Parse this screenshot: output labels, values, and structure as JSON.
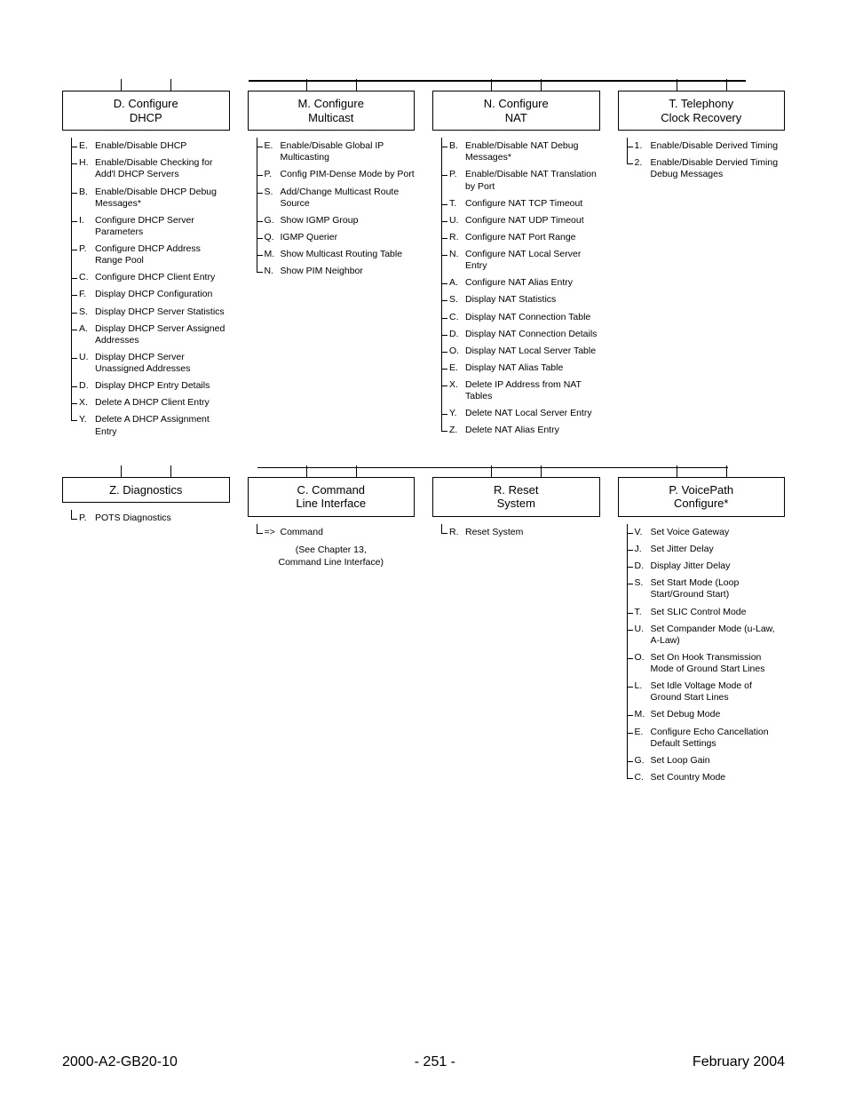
{
  "row1": {
    "cols": [
      {
        "header": "D. Configure\nDHCP",
        "items": [
          {
            "k": "E.",
            "t": "Enable/Disable DHCP"
          },
          {
            "k": "H.",
            "t": "Enable/Disable Checking for Add'l DHCP Servers"
          },
          {
            "k": "B.",
            "t": "Enable/Disable DHCP Debug Messages*"
          },
          {
            "k": "I.",
            "t": "Configure DHCP Server Parameters"
          },
          {
            "k": "P.",
            "t": "Configure DHCP Address Range Pool"
          },
          {
            "k": "C.",
            "t": "Configure DHCP Client Entry"
          },
          {
            "k": "F.",
            "t": "Display DHCP Configuration"
          },
          {
            "k": "S.",
            "t": "Display DHCP Server Statistics"
          },
          {
            "k": "A.",
            "t": "Display DHCP Server Assigned Addresses"
          },
          {
            "k": "U.",
            "t": "Display DHCP Server Unassigned Addresses"
          },
          {
            "k": "D.",
            "t": "Display DHCP Entry Details"
          },
          {
            "k": "X.",
            "t": "Delete A DHCP Client Entry"
          },
          {
            "k": "Y.",
            "t": "Delete A DHCP Assignment Entry"
          }
        ]
      },
      {
        "header": "M. Configure\nMulticast",
        "items": [
          {
            "k": "E.",
            "t": "Enable/Disable Global IP Multicasting"
          },
          {
            "k": "P.",
            "t": "Config PIM-Dense Mode by Port"
          },
          {
            "k": "S.",
            "t": "Add/Change Multicast Route Source"
          },
          {
            "k": "G.",
            "t": "Show IGMP Group"
          },
          {
            "k": "Q.",
            "t": "IGMP Querier"
          },
          {
            "k": "M.",
            "t": "Show Multicast Routing Table"
          },
          {
            "k": "N.",
            "t": "Show PIM Neighbor"
          }
        ]
      },
      {
        "header": "N. Configure\nNAT",
        "items": [
          {
            "k": "B.",
            "t": "Enable/Disable NAT Debug Messages*"
          },
          {
            "k": "P.",
            "t": "Enable/Disable NAT Translation by Port"
          },
          {
            "k": "T.",
            "t": "Configure NAT TCP Timeout"
          },
          {
            "k": "U.",
            "t": "Configure NAT UDP Timeout"
          },
          {
            "k": "R.",
            "t": "Configure NAT Port Range"
          },
          {
            "k": "N.",
            "t": "Configure NAT Local Server Entry"
          },
          {
            "k": "A.",
            "t": "Configure NAT Alias Entry"
          },
          {
            "k": "S.",
            "t": "Display NAT Statistics"
          },
          {
            "k": "C.",
            "t": "Display NAT Connection Table"
          },
          {
            "k": "D.",
            "t": "Display NAT Connection Details"
          },
          {
            "k": "O.",
            "t": "Display NAT Local Server Table"
          },
          {
            "k": "E.",
            "t": "Display NAT Alias Table"
          },
          {
            "k": "X.",
            "t": "Delete IP Address from NAT Tables"
          },
          {
            "k": "Y.",
            "t": "Delete NAT Local Server Entry"
          },
          {
            "k": "Z.",
            "t": "Delete NAT Alias Entry"
          }
        ]
      },
      {
        "header": "T. Telephony\nClock Recovery",
        "items": [
          {
            "k": "1.",
            "t": "Enable/Disable Derived Timing"
          },
          {
            "k": "2.",
            "t": "Enable/Disable Dervied Timing Debug Messages"
          }
        ]
      }
    ]
  },
  "row2": {
    "cols": [
      {
        "header": "Z. Diagnostics",
        "items": [
          {
            "k": "P.",
            "t": "POTS Diagnostics"
          }
        ]
      },
      {
        "header": "C. Command\nLine Interface",
        "items": [
          {
            "k": "=>",
            "t": "Command"
          }
        ],
        "note": "(See Chapter 13,\nCommand Line Interface)"
      },
      {
        "header": "R. Reset\nSystem",
        "items": [
          {
            "k": "R.",
            "t": "Reset System"
          }
        ]
      },
      {
        "header": "P. VoicePath\nConfigure*",
        "items": [
          {
            "k": "V.",
            "t": "Set Voice Gateway"
          },
          {
            "k": "J.",
            "t": "Set Jitter Delay"
          },
          {
            "k": "D.",
            "t": "Display Jitter Delay"
          },
          {
            "k": "S.",
            "t": "Set Start Mode (Loop Start/Ground Start)"
          },
          {
            "k": "T.",
            "t": "Set SLIC Control Mode"
          },
          {
            "k": "U.",
            "t": "Set Compander Mode (u-Law, A-Law)"
          },
          {
            "k": "O.",
            "t": "Set On Hook Transmission Mode of Ground Start Lines"
          },
          {
            "k": "L.",
            "t": "Set Idle Voltage Mode of Ground Start Lines"
          },
          {
            "k": "M.",
            "t": "Set Debug Mode"
          },
          {
            "k": "E.",
            "t": "Configure Echo Cancellation Default Settings"
          },
          {
            "k": "G.",
            "t": "Set Loop Gain"
          },
          {
            "k": "C.",
            "t": "Set Country Mode"
          }
        ]
      }
    ]
  },
  "footer": {
    "left": "2000-A2-GB20-10",
    "center": "- 251 -",
    "right": "February 2004"
  }
}
